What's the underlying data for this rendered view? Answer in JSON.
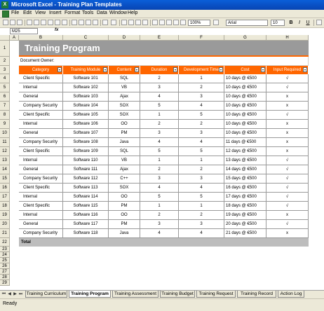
{
  "window": {
    "title": "Microsoft Excel - Training Plan Templates"
  },
  "menu": [
    "File",
    "Edit",
    "View",
    "Insert",
    "Format",
    "Tools",
    "Data",
    "Window",
    "Help"
  ],
  "toolbar": {
    "zoom": "100%",
    "font": "Arial",
    "size": "10",
    "bold": "B",
    "italic": "I",
    "underline": "U"
  },
  "formula_bar": {
    "name_box": "M25",
    "fx": "fx"
  },
  "columns": [
    "A",
    "B",
    "C",
    "D",
    "E",
    "F",
    "G",
    "H"
  ],
  "rows": [
    "1",
    "2",
    "3",
    "4",
    "5",
    "6",
    "7",
    "8",
    "9",
    "10",
    "11",
    "12",
    "13",
    "14",
    "15",
    "16",
    "17",
    "18",
    "19",
    "20",
    "21",
    "22",
    "23",
    "24",
    "25",
    "26",
    "27",
    "28",
    "29"
  ],
  "sheet": {
    "banner": "Training Program",
    "doc_owner": "Document Owner:",
    "headers": [
      "Category",
      "Training Module",
      "Content",
      "Duration",
      "Development Time",
      "Cost",
      "Input Required"
    ],
    "data": [
      [
        "Client Specific",
        "Software 101",
        "SQL",
        "2",
        "1",
        "10 days @ €500",
        "√"
      ],
      [
        "Internal",
        "Software 102",
        "VB",
        "3",
        "2",
        "10 days @ €500",
        "√"
      ],
      [
        "General",
        "Software 103",
        "Ajax",
        "4",
        "3",
        "10 days @ €500",
        "x"
      ],
      [
        "Company Security",
        "Software 104",
        "SOX",
        "5",
        "4",
        "10 days @ €500",
        "x"
      ],
      [
        "Client Specific",
        "Software 105",
        "SOX",
        "1",
        "5",
        "10 days @ €500",
        "√"
      ],
      [
        "Internal",
        "Software 106",
        "OO",
        "2",
        "2",
        "10 days @ €500",
        "x"
      ],
      [
        "General",
        "Software 107",
        "PM",
        "3",
        "3",
        "10 days @ €500",
        "x"
      ],
      [
        "Company Security",
        "Software 108",
        "Java",
        "4",
        "4",
        "11 days @ €500",
        "x"
      ],
      [
        "Client Specific",
        "Software 109",
        "SQL",
        "5",
        "5",
        "12 days @ €500",
        "x"
      ],
      [
        "Internal",
        "Software 110",
        "VB",
        "1",
        "1",
        "13 days @ €500",
        "√"
      ],
      [
        "General",
        "Software 111",
        "Ajax",
        "2",
        "2",
        "14 days @ €500",
        "√"
      ],
      [
        "Company Security",
        "Software 112",
        "C++",
        "3",
        "3",
        "15 days @ €500",
        "√"
      ],
      [
        "Client Specific",
        "Software 113",
        "SOX",
        "4",
        "4",
        "16 days @ €500",
        "√"
      ],
      [
        "Internal",
        "Software 114",
        "OO",
        "5",
        "5",
        "17 days @ €500",
        "√"
      ],
      [
        "Client Specific",
        "Software 115",
        "PM",
        "1",
        "1",
        "18 days @ €500",
        "√"
      ],
      [
        "Internal",
        "Software 116",
        "OO",
        "2",
        "2",
        "19 days @ €500",
        "x"
      ],
      [
        "General",
        "Software 117",
        "PM",
        "3",
        "3",
        "20 days @ €500",
        "√"
      ],
      [
        "Company Security",
        "Software 118",
        "Java",
        "4",
        "4",
        "21 days @ €500",
        "x"
      ]
    ],
    "total_label": "Total"
  },
  "tabs": [
    "Training Curriculum",
    "Training Program",
    "Training Assessment",
    "Training Budget",
    "Training Request",
    "Training Record",
    "Action Log"
  ],
  "active_tab": "Training Program",
  "status": "Ready",
  "colors": {
    "accent": "#ff6600",
    "banner": "#9a9a9a",
    "total": "#bdbdbd"
  }
}
